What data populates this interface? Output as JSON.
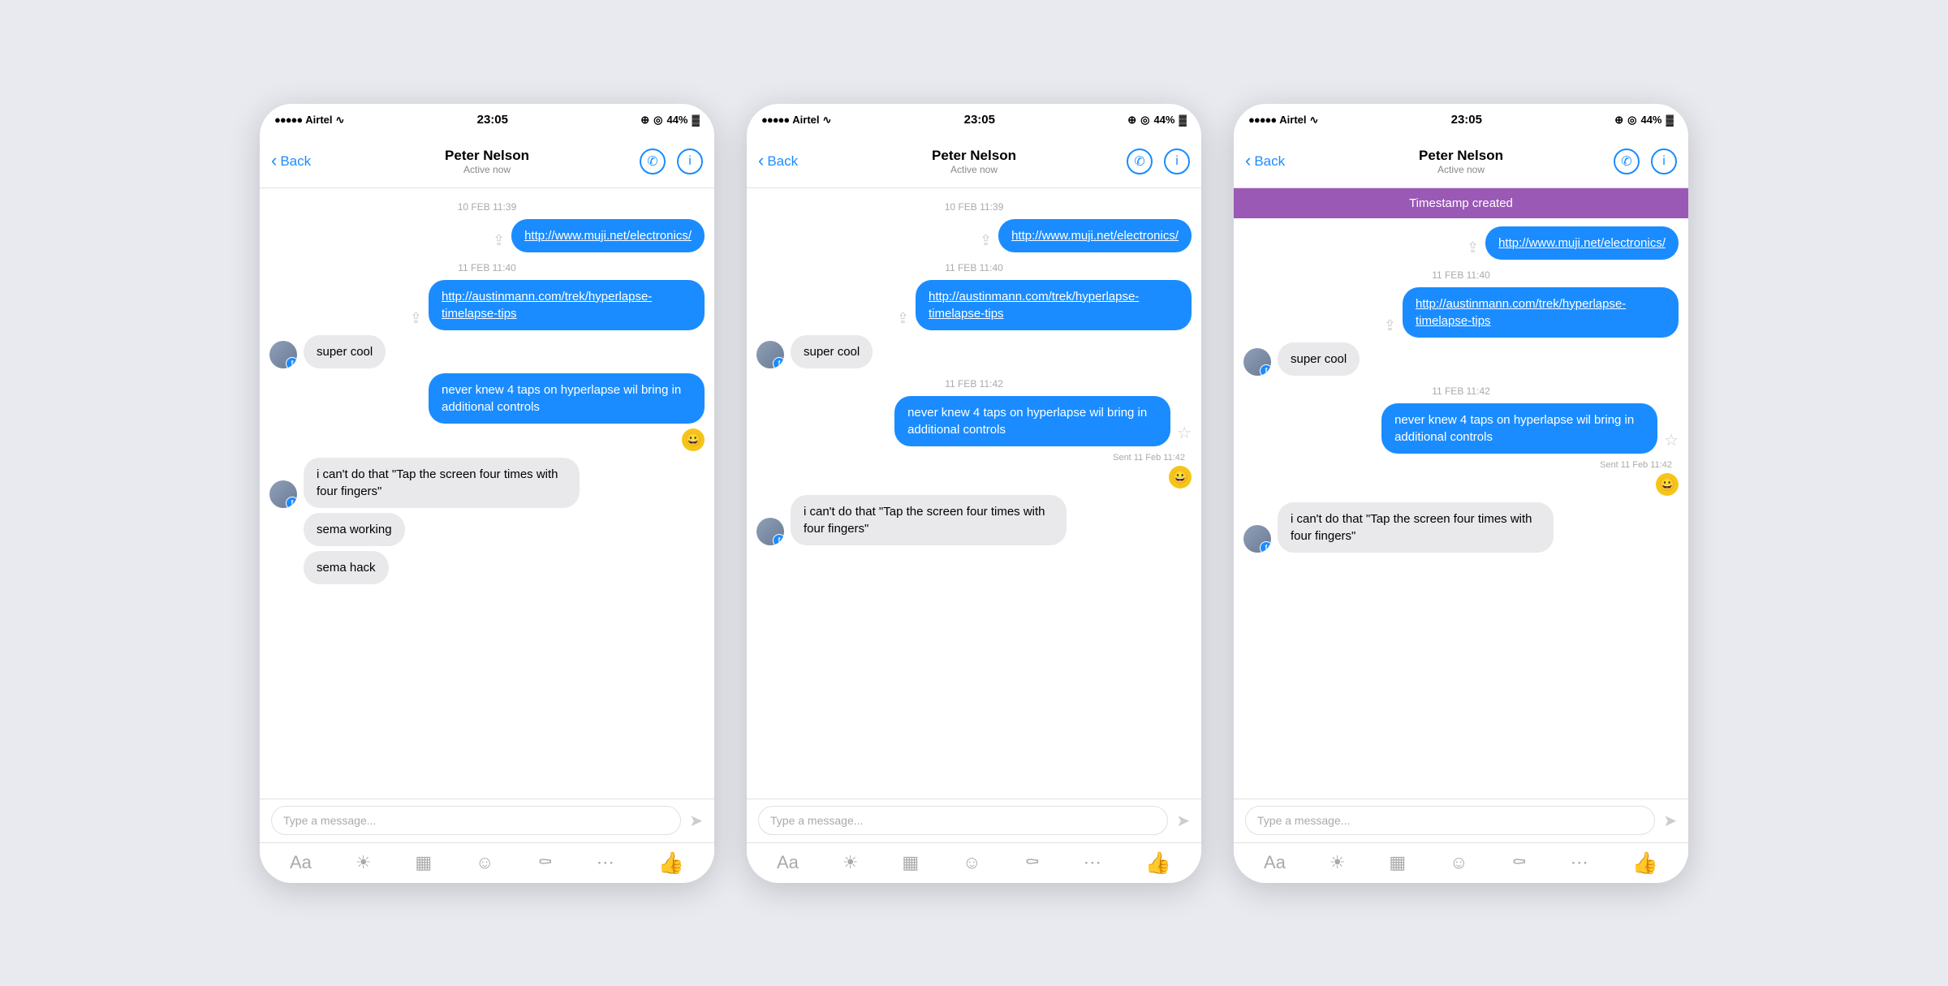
{
  "shared": {
    "carrier": "●●●●● Airtel",
    "wifi": "WiFi",
    "time": "23:05",
    "battery": "44%",
    "contact_name": "Peter Nelson",
    "active_status": "Active now",
    "back_label": "Back",
    "phone_icon": "📞",
    "info_icon": "ⓘ",
    "type_placeholder": "Type a message...",
    "send_icon": "➤"
  },
  "phones": [
    {
      "id": "phone1",
      "timestamp_highlight": null,
      "messages": [
        {
          "type": "timestamp",
          "text": "10 FEB 11:39"
        },
        {
          "type": "outgoing_link",
          "text": "http://www.muji.net/electronics/"
        },
        {
          "type": "timestamp",
          "text": "11 FEB 11:40"
        },
        {
          "type": "outgoing_link",
          "text": "http://austinmann.com/trek/hyperlapse-timelapse-tips"
        },
        {
          "type": "incoming",
          "text": "super cool",
          "has_avatar": true
        },
        {
          "type": "outgoing",
          "text": "never knew 4 taps on hyperlapse wil bring in additional controls"
        },
        {
          "type": "emoji_react",
          "emoji": "😀"
        },
        {
          "type": "incoming",
          "text": "i can't do that \"Tap the screen four times with four fingers\"",
          "has_avatar": true
        },
        {
          "type": "incoming_plain",
          "text": "sema working"
        },
        {
          "type": "incoming_plain",
          "text": "sema hack"
        }
      ]
    },
    {
      "id": "phone2",
      "timestamp_highlight": null,
      "messages": [
        {
          "type": "timestamp",
          "text": "10 FEB 11:39"
        },
        {
          "type": "outgoing_link",
          "text": "http://www.muji.net/electronics/"
        },
        {
          "type": "timestamp",
          "text": "11 FEB 11:40"
        },
        {
          "type": "outgoing_link",
          "text": "http://austinmann.com/trek/hyperlapse-timelapse-tips"
        },
        {
          "type": "incoming",
          "text": "super cool",
          "has_avatar": true
        },
        {
          "type": "timestamp",
          "text": "11 FEB 11:42"
        },
        {
          "type": "outgoing_star",
          "text": "never knew 4 taps on hyperlapse wil bring in additional controls",
          "star": false
        },
        {
          "type": "sent_label",
          "text": "Sent 11 Feb 11:42"
        },
        {
          "type": "emoji_react",
          "emoji": "😀"
        },
        {
          "type": "incoming",
          "text": "i can't do that \"Tap the screen four times with four fingers\"",
          "has_avatar": true
        }
      ]
    },
    {
      "id": "phone3",
      "timestamp_highlight": "Timestamp created",
      "messages": [
        {
          "type": "outgoing_link",
          "text": "http://www.muji.net/electronics/"
        },
        {
          "type": "timestamp",
          "text": "11 FEB 11:40"
        },
        {
          "type": "outgoing_link",
          "text": "http://austinmann.com/trek/hyperlapse-timelapse-tips"
        },
        {
          "type": "incoming",
          "text": "super cool",
          "has_avatar": true
        },
        {
          "type": "timestamp",
          "text": "11 FEB 11:42"
        },
        {
          "type": "outgoing_star",
          "text": "never knew 4 taps on hyperlapse wil bring in additional controls",
          "star": false
        },
        {
          "type": "sent_label",
          "text": "Sent 11 Feb 11:42"
        },
        {
          "type": "emoji_react",
          "emoji": "😀"
        },
        {
          "type": "incoming",
          "text": "i can't do that \"Tap the screen four times with four fingers\"",
          "has_avatar": true
        }
      ]
    }
  ]
}
